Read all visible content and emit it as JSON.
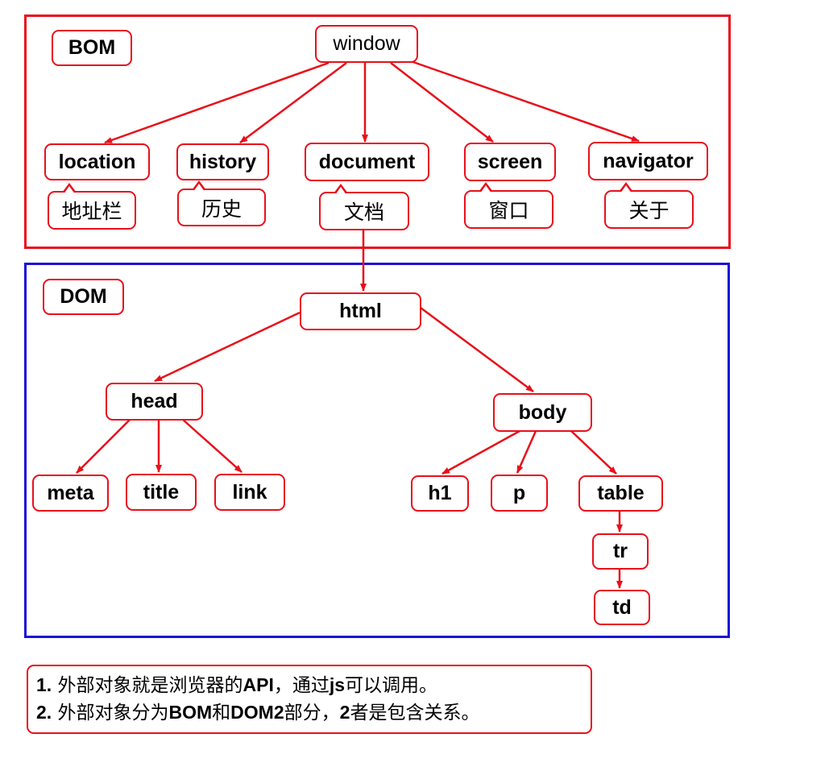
{
  "colors": {
    "bom_border": "#e8101a",
    "dom_border": "#1a10d8",
    "node_border": "#e8101a",
    "arrow": "#e8101a"
  },
  "regions": {
    "bom_label": "BOM",
    "dom_label": "DOM"
  },
  "nodes": {
    "window": "window",
    "location": "location",
    "history": "history",
    "document": "document",
    "screen": "screen",
    "navigator": "navigator",
    "html": "html",
    "head": "head",
    "body": "body",
    "meta": "meta",
    "title": "title",
    "link": "link",
    "h1": "h1",
    "p": "p",
    "table": "table",
    "tr": "tr",
    "td": "td"
  },
  "callouts": {
    "location": "地址栏",
    "history": "历史",
    "document": "文档",
    "screen": "窗口",
    "navigator": "关于"
  },
  "notes": {
    "line1": {
      "num": "1.",
      "pre": "外部对象就是浏览器的",
      "api": "API",
      "mid": "，通过",
      "js": "js",
      "post": "可以调用。"
    },
    "line2": {
      "num": "2.",
      "pre": "外部对象分为",
      "bom": "BOM",
      "and": "和",
      "dom": "DOM",
      "two": "2",
      "mid": "部分，",
      "two2": "2",
      "post": "者是包含关系。"
    }
  }
}
